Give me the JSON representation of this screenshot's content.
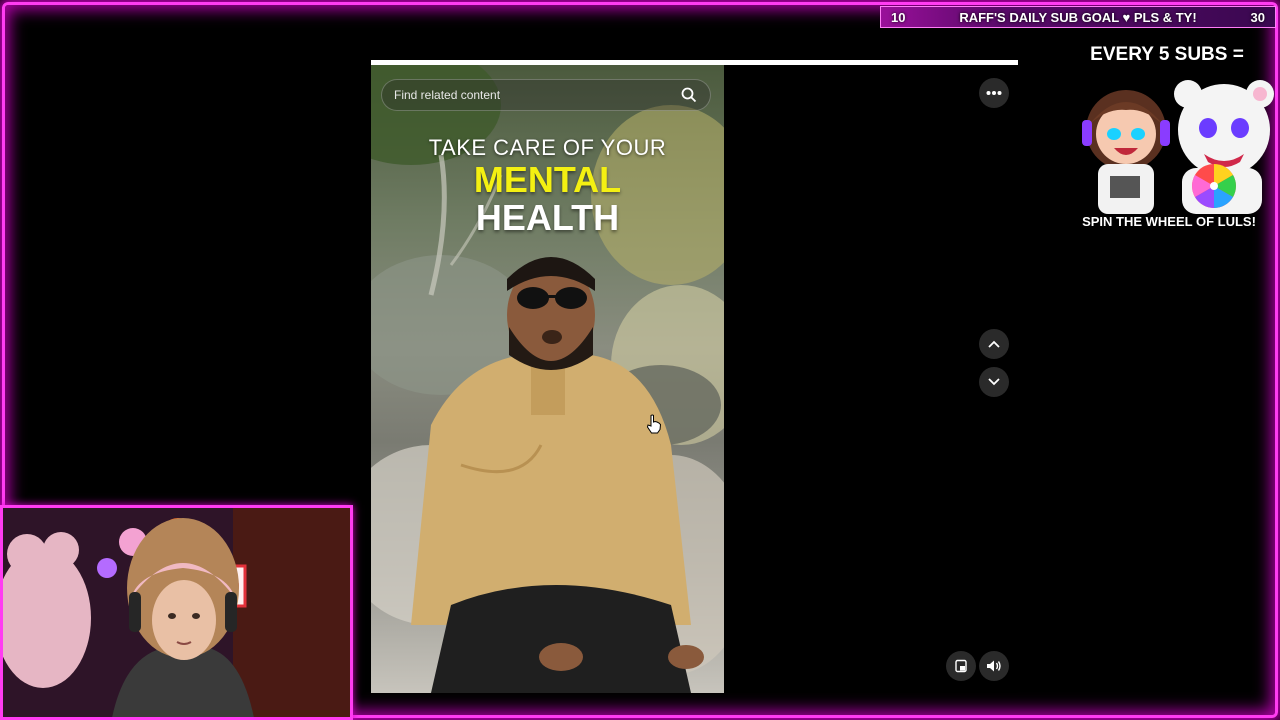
{
  "subgoal": {
    "current": "10",
    "label": "RAFF'S DAILY SUB GOAL ♥ PLS & TY!",
    "target": "30"
  },
  "promo": {
    "title": "EVERY 5 SUBS =",
    "caption": "SPIN THE WHEEL OF LULS!"
  },
  "player": {
    "search_placeholder": "Find related content",
    "video_caption": {
      "line1": "TAKE CARE OF YOUR",
      "line2": "MENTAL",
      "line3": "HEALTH"
    },
    "icons": {
      "search": "search-icon",
      "more": "more-options-icon",
      "prev": "chevron-up-icon",
      "next": "chevron-down-icon",
      "miniplayer": "miniplayer-icon",
      "volume": "volume-icon"
    }
  },
  "colors": {
    "neon": "#ff3cf2",
    "caption_yellow": "#f4f012",
    "button_bg": "#2a2a2a"
  }
}
